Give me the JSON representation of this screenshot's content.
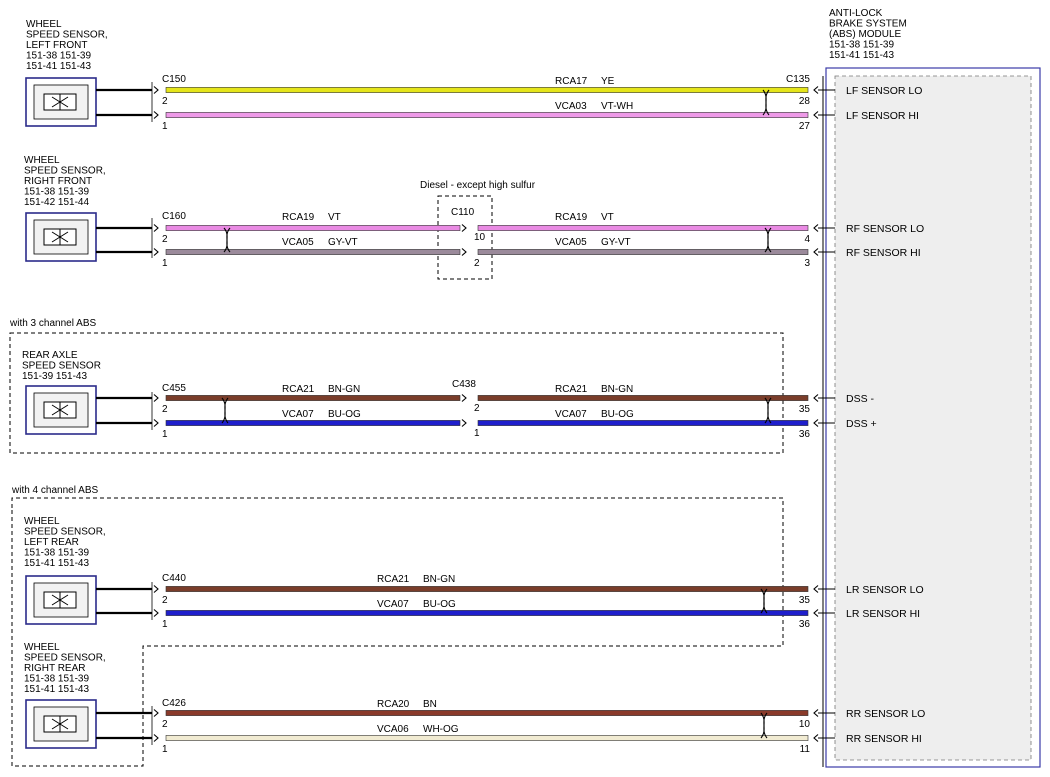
{
  "module": {
    "title_lines": [
      "ANTI-LOCK",
      "BRAKE SYSTEM",
      "(ABS) MODULE",
      "151-38   151-39",
      "151-41   151-43"
    ],
    "connector": "C135"
  },
  "colors": {
    "frame": "#3b3ba8",
    "YE": "#e5e51a",
    "VT": "#e98ae3",
    "VT-WH": "#ee9ae8",
    "GY-VT": "#9b8a9b",
    "BN-GN": "#7a3d2a",
    "BU-OG": "#1f1fcc",
    "BN": "#8a3a2a",
    "WH-OG": "#f1ebd2"
  },
  "sensors": [
    {
      "id": "lf",
      "lines": [
        "WHEEL",
        "SPEED SENSOR,",
        "LEFT FRONT",
        "151-38   151-39",
        "151-41   151-43"
      ]
    },
    {
      "id": "rf",
      "lines": [
        "WHEEL",
        "SPEED SENSOR,",
        "RIGHT FRONT",
        "151-38   151-39",
        "151-42   151-44"
      ]
    },
    {
      "id": "ra",
      "lines": [
        "REAR AXLE",
        "SPEED SENSOR",
        "151-39   151-43"
      ]
    },
    {
      "id": "lr",
      "lines": [
        "WHEEL",
        "SPEED SENSOR,",
        "LEFT REAR",
        "151-38   151-39",
        "151-41   151-43"
      ]
    },
    {
      "id": "rr",
      "lines": [
        "WHEEL",
        "SPEED SENSOR,",
        "RIGHT REAR",
        "151-38   151-39",
        "151-41   151-43"
      ]
    }
  ],
  "groups": {
    "three_channel": "with 3 channel ABS",
    "four_channel": "with 4 channel ABS",
    "diesel": "Diesel - except high sulfur"
  },
  "connectors": {
    "c150": "C150",
    "c160": "C160",
    "c110": "C110",
    "c455": "C455",
    "c438": "C438",
    "c440": "C440",
    "c426": "C426"
  },
  "circuits": [
    {
      "id": "lf-lo",
      "segments": [
        {
          "circuit": "RCA17",
          "color": "YE"
        }
      ],
      "pins": {
        "sensor": "2",
        "module": "28"
      },
      "signal": "LF SENSOR LO"
    },
    {
      "id": "lf-hi",
      "segments": [
        {
          "circuit": "VCA03",
          "color": "VT-WH"
        }
      ],
      "pins": {
        "sensor": "1",
        "module": "27"
      },
      "signal": "LF SENSOR HI"
    },
    {
      "id": "rf-lo",
      "segments": [
        {
          "circuit": "RCA19",
          "color": "VT"
        },
        {
          "circuit": "RCA19",
          "color": "VT"
        }
      ],
      "pins": {
        "sensor": "2",
        "inline": "10",
        "module": "4"
      },
      "signal": "RF SENSOR LO"
    },
    {
      "id": "rf-hi",
      "segments": [
        {
          "circuit": "VCA05",
          "color": "GY-VT"
        },
        {
          "circuit": "VCA05",
          "color": "GY-VT"
        }
      ],
      "pins": {
        "sensor": "1",
        "inline": "2",
        "module": "3"
      },
      "signal": "RF SENSOR HI"
    },
    {
      "id": "dss-minus",
      "segments": [
        {
          "circuit": "RCA21",
          "color": "BN-GN"
        },
        {
          "circuit": "RCA21",
          "color": "BN-GN"
        }
      ],
      "pins": {
        "sensor": "2",
        "inline": "2",
        "module": "35"
      },
      "signal": "DSS -"
    },
    {
      "id": "dss-plus",
      "segments": [
        {
          "circuit": "VCA07",
          "color": "BU-OG"
        },
        {
          "circuit": "VCA07",
          "color": "BU-OG"
        }
      ],
      "pins": {
        "sensor": "1",
        "inline": "1",
        "module": "36"
      },
      "signal": "DSS +"
    },
    {
      "id": "lr-lo",
      "segments": [
        {
          "circuit": "RCA21",
          "color": "BN-GN"
        }
      ],
      "pins": {
        "sensor": "2",
        "module": "35"
      },
      "signal": "LR SENSOR LO"
    },
    {
      "id": "lr-hi",
      "segments": [
        {
          "circuit": "VCA07",
          "color": "BU-OG"
        }
      ],
      "pins": {
        "sensor": "1",
        "module": "36"
      },
      "signal": "LR SENSOR HI"
    },
    {
      "id": "rr-lo",
      "segments": [
        {
          "circuit": "RCA20",
          "color": "BN"
        }
      ],
      "pins": {
        "sensor": "2",
        "module": "10"
      },
      "signal": "RR SENSOR LO"
    },
    {
      "id": "rr-hi",
      "segments": [
        {
          "circuit": "VCA06",
          "color": "WH-OG"
        }
      ],
      "pins": {
        "sensor": "1",
        "module": "11"
      },
      "signal": "RR SENSOR HI"
    }
  ]
}
